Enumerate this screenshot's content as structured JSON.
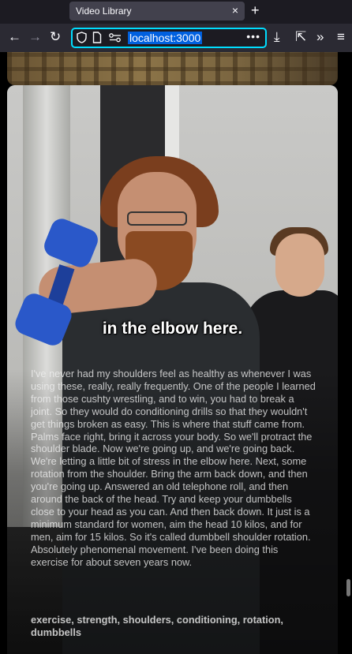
{
  "browser": {
    "tab_title": "Video Library",
    "tab_close": "×",
    "new_tab": "+",
    "url": "localhost:3000",
    "back": "←",
    "forward": "→",
    "reload": "↻",
    "page_actions": "•••",
    "download": "⤓",
    "extensions": "⇱",
    "overflow": "»",
    "menu": "≡"
  },
  "video": {
    "caption": "in the elbow here.",
    "transcript": "I've never had my shoulders feel as healthy as whenever I was using these, really, really frequently. One of the people I learned from those cushty wrestling, and to win, you had to break a joint. So they would do conditioning drills so that they wouldn't get things broken as easy. This is where that stuff came from. Palms face right, bring it across your body. So we'll protract the shoulder blade. Now we're going up, and we're going back. We're letting a little bit of stress in the elbow here. Next, some rotation from the shoulder. Bring the arm back down, and then you're going up. Answered an old telephone roll, and then around the back of the head. Try and keep your dumbbells close to your head as you can. And then back down. It just is a minimum standard for women, aim the head 10 kilos, and for men, aim for 15 kilos. So it's called dumbbell shoulder rotation. Absolutely phenomenal movement. I've been doing this exercise for about seven years now.",
    "tags": "exercise, strength, shoulders, conditioning, rotation, dumbbells"
  }
}
